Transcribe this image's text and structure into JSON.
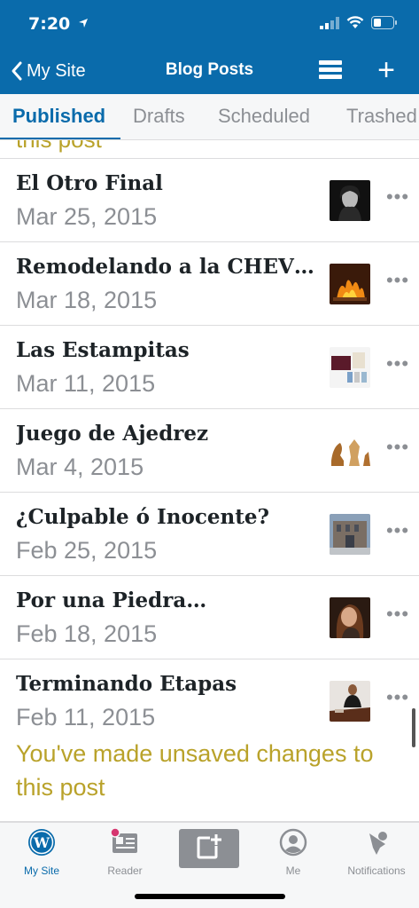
{
  "status_bar": {
    "time": "7:20"
  },
  "nav": {
    "back_label": "My Site",
    "title": "Blog Posts"
  },
  "tabs": [
    {
      "label": "Published",
      "active": true
    },
    {
      "label": "Drafts",
      "active": false
    },
    {
      "label": "Scheduled",
      "active": false
    },
    {
      "label": "Trashed",
      "active": false
    }
  ],
  "partial_note": "this post",
  "posts": [
    {
      "title": "El Otro Final",
      "date": "Mar 25, 2015",
      "thumb_icon": "portrait-photo-thumbnail"
    },
    {
      "title": "Remodelando a la CHEV…",
      "date": "Mar 18, 2015",
      "thumb_icon": "fireplace-photo-thumbnail"
    },
    {
      "title": "Las Estampitas",
      "date": "Mar 11, 2015",
      "thumb_icon": "prayer-cards-photo-thumbnail"
    },
    {
      "title": "Juego de Ajedrez",
      "date": "Mar 4, 2015",
      "thumb_icon": "chess-pieces-photo-thumbnail"
    },
    {
      "title": "¿Culpable ó Inocente?",
      "date": "Feb 25, 2015",
      "thumb_icon": "building-photo-thumbnail"
    },
    {
      "title": "Por una Piedra…",
      "date": "Feb 18, 2015",
      "thumb_icon": "woman-photo-thumbnail"
    },
    {
      "title": "Terminando Etapas",
      "date": "Feb 11, 2015",
      "thumb_icon": "man-at-desk-photo-thumbnail"
    }
  ],
  "post_more_label": "•••",
  "warning": "You've made unsaved changes to this post",
  "tab_bar": [
    {
      "label": "My Site",
      "icon": "wordpress-logo-icon",
      "active": true
    },
    {
      "label": "Reader",
      "icon": "reader-icon",
      "active": false
    },
    {
      "label": "",
      "icon": "new-post-icon",
      "active": false
    },
    {
      "label": "Me",
      "icon": "user-icon",
      "active": false
    },
    {
      "label": "Notifications",
      "icon": "bell-icon",
      "active": false
    }
  ],
  "colors": {
    "brand": "#0a6bab",
    "warning": "#b9a22a",
    "muted": "#8c8f94",
    "notification_dot": "#d63670"
  }
}
